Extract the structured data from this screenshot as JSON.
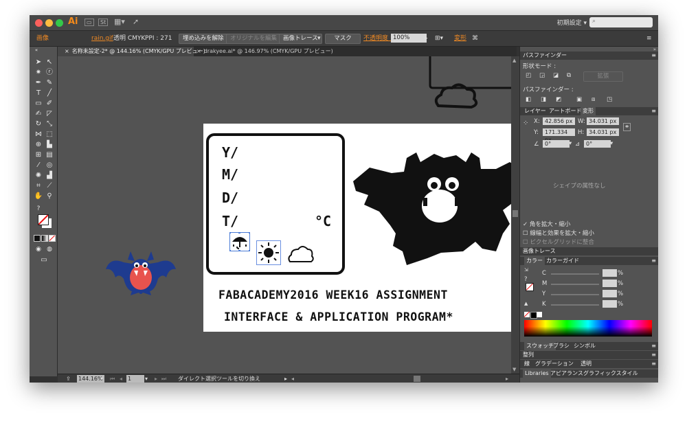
{
  "app": {
    "logo": "Ai",
    "st_button": "St",
    "workspace": "初期設定"
  },
  "control_bar": {
    "object_type": "画像",
    "file_name": "rain.gif",
    "color_mode": "透明 CMYK",
    "ppi": "PPI : 271",
    "unembed": "埋め込みを解除",
    "edit_original": "オリジナルを編集",
    "image_trace": "画像トレース",
    "mask": "マスク",
    "opacity_label": "不透明度 :",
    "opacity_value": "100%",
    "transform": "変形"
  },
  "tabs": [
    {
      "label": "名称未設定-2* @ 144.16% (CMYK/GPU プレビュー)"
    },
    {
      "label": "drakyee.ai* @ 146.97% (CMYK/GPU プレビュー)"
    }
  ],
  "artboard": {
    "lines": [
      "Y/",
      "M/",
      "D/",
      "T/"
    ],
    "temp_unit": "°C",
    "footer_line1": "FABACADEMY2016 WEEK16 ASSIGNMENT",
    "footer_line2": "INTERFACE & APPLICATION PROGRAM*"
  },
  "status": {
    "zoom": "144.16%",
    "artboard_num": "1",
    "tool_hint": "ダイレクト選択ツールを切り換え"
  },
  "panels": {
    "pathfinder": {
      "title": "パスファインダー",
      "shape_modes": "形状モード :",
      "expand": "拡張",
      "pathfinders": "パスファインダー :"
    },
    "layers_tabs": {
      "layers": "レイヤー",
      "artboards": "アートボード",
      "transform": "変形"
    },
    "transform": {
      "x_label": "X:",
      "x_value": "42.856 px",
      "y_label": "Y:",
      "y_value": "171.334 px",
      "w_label": "W:",
      "w_value": "34.031 px",
      "h_label": "H:",
      "h_value": "34.031 px",
      "shear": "0°",
      "rotate": "0°",
      "no_attributes": "シェイプの属性なし",
      "scale_corners": "角を拡大・縮小",
      "scale_strokes": "線幅と効果を拡大・縮小",
      "align_pixel": "ピクセルグリッドに整合"
    },
    "image_trace": "画像トレース",
    "color": {
      "tab1": "カラー",
      "tab2": "カラーガイド",
      "c": "C",
      "m": "M",
      "y": "Y",
      "k": "K",
      "pct": "%"
    },
    "swatches_tabs": {
      "swatches": "スウォッチ",
      "brushes": "ブラシ",
      "symbols": "シンボル"
    },
    "align": "整列",
    "stroke_tabs": {
      "stroke": "線",
      "gradient": "グラデーション",
      "transparency": "透明"
    },
    "bottom_tabs": {
      "libraries": "Libraries",
      "appearance": "アピアランス",
      "graphic_styles": "グラフィックスタイル"
    }
  },
  "colors": {
    "accent": "#f08a24",
    "monster_body": "#1e3b8f",
    "monster_face": "#e8534e"
  }
}
